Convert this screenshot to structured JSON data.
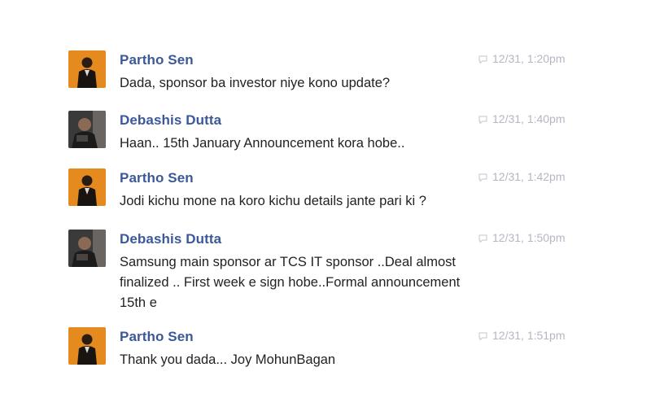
{
  "conversation": {
    "messages": [
      {
        "sender": "Partho Sen",
        "avatar": "partho-avatar",
        "timestamp": "12/31, 1:20pm",
        "lines": [
          "Dada, sponsor ba investor niye kono update?"
        ]
      },
      {
        "sender": "Debashis Dutta",
        "avatar": "debashis-avatar",
        "timestamp": "12/31, 1:40pm",
        "lines": [
          "Haan.. 15th January Announcement kora hobe.."
        ]
      },
      {
        "sender": "Partho Sen",
        "avatar": "partho-avatar",
        "timestamp": "12/31, 1:42pm",
        "lines": [
          "Jodi kichu mone na koro kichu details jante pari ki ?"
        ]
      },
      {
        "sender": "Debashis Dutta",
        "avatar": "debashis-avatar",
        "timestamp": "12/31, 1:50pm",
        "lines": [
          "Samsung main sponsor ar TCS IT sponsor ..Deal almost",
          "finalized .. First week e sign hobe..Formal announcement",
          "15th e"
        ]
      },
      {
        "sender": "Partho Sen",
        "avatar": "partho-avatar",
        "timestamp": "12/31, 1:51pm",
        "lines": [
          "Thank you dada... Joy MohunBagan"
        ]
      }
    ]
  },
  "colors": {
    "sender_name": "#3b5998",
    "message_text": "#222222",
    "timestamp": "#b4b6c4",
    "partho_avatar_bg": "#e58a1f",
    "debashis_avatar_bg": "#3a3a3a"
  },
  "icons": {
    "timestamp_icon": "chat-bubble-icon"
  }
}
